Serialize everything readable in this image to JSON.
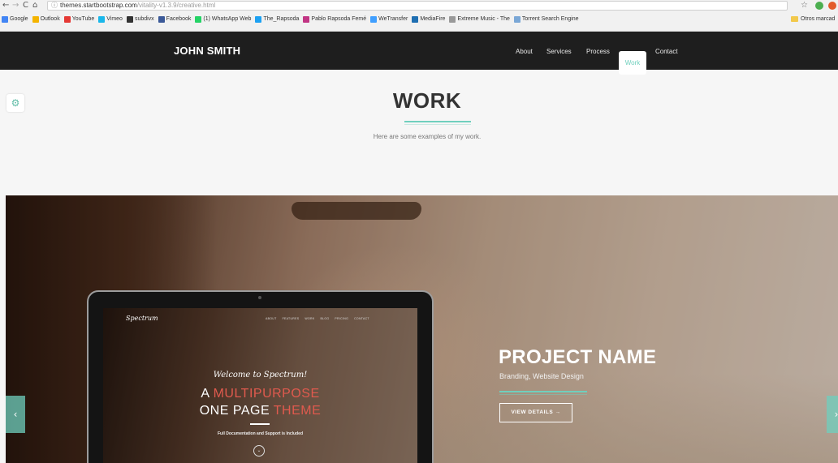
{
  "browser": {
    "back_icon": "←",
    "forward_icon": "→",
    "reload_icon": "C",
    "home_icon": "⌂",
    "url_host": "themes.startbootstrap.com",
    "url_path": "/vitality-v1.3.9/creative.html",
    "bookmarks": [
      {
        "label": "Google",
        "color": "#4285f4"
      },
      {
        "label": "Outlook",
        "color": "#f4b400"
      },
      {
        "label": "YouTube",
        "color": "#e53935"
      },
      {
        "label": "Vimeo",
        "color": "#1ab7ea"
      },
      {
        "label": "subdivx",
        "color": "#333333"
      },
      {
        "label": "Facebook",
        "color": "#3b5998"
      },
      {
        "label": "(1) WhatsApp Web",
        "color": "#25d366"
      },
      {
        "label": "The_Rapsoda",
        "color": "#1da1f2"
      },
      {
        "label": "Pablo Rapsoda Femé",
        "color": "#c13584"
      },
      {
        "label": "WeTransfer",
        "color": "#409fff"
      },
      {
        "label": "MediaFire",
        "color": "#1f6fb2"
      },
      {
        "label": "Extreme Music - The",
        "color": "#999999"
      },
      {
        "label": "Torrent Search Engine",
        "color": "#7aa7d6"
      }
    ],
    "other_bookmarks": "Otros marcad"
  },
  "navbar": {
    "brand": "JOHN SMITH",
    "links": [
      "About",
      "Services",
      "Process",
      "Work",
      "Contact"
    ],
    "active": "Work"
  },
  "work": {
    "title": "WORK",
    "subtitle": "Here are some examples of my work."
  },
  "laptop_screen": {
    "logo": "Spectrum",
    "nav": [
      "ABOUT",
      "FEATURES",
      "WORK",
      "BLOG",
      "PRICING",
      "CONTACT"
    ],
    "welcome": "Welcome to Spectrum!",
    "line1_a": "A ",
    "line1_b": "MULTIPURPOSE",
    "line2_a": "ONE PAGE ",
    "line2_b": "THEME",
    "doc": "Full Documentation and Support is Included"
  },
  "project": {
    "name": "PROJECT NAME",
    "categories": "Branding, Website Design",
    "button": "VIEW DETAILS →"
  },
  "carousel": {
    "prev": "‹",
    "next": "›"
  },
  "colors": {
    "accent": "#6fcfbd",
    "navbar": "#1e1e1e",
    "theme_accent": "#e05a4e"
  }
}
